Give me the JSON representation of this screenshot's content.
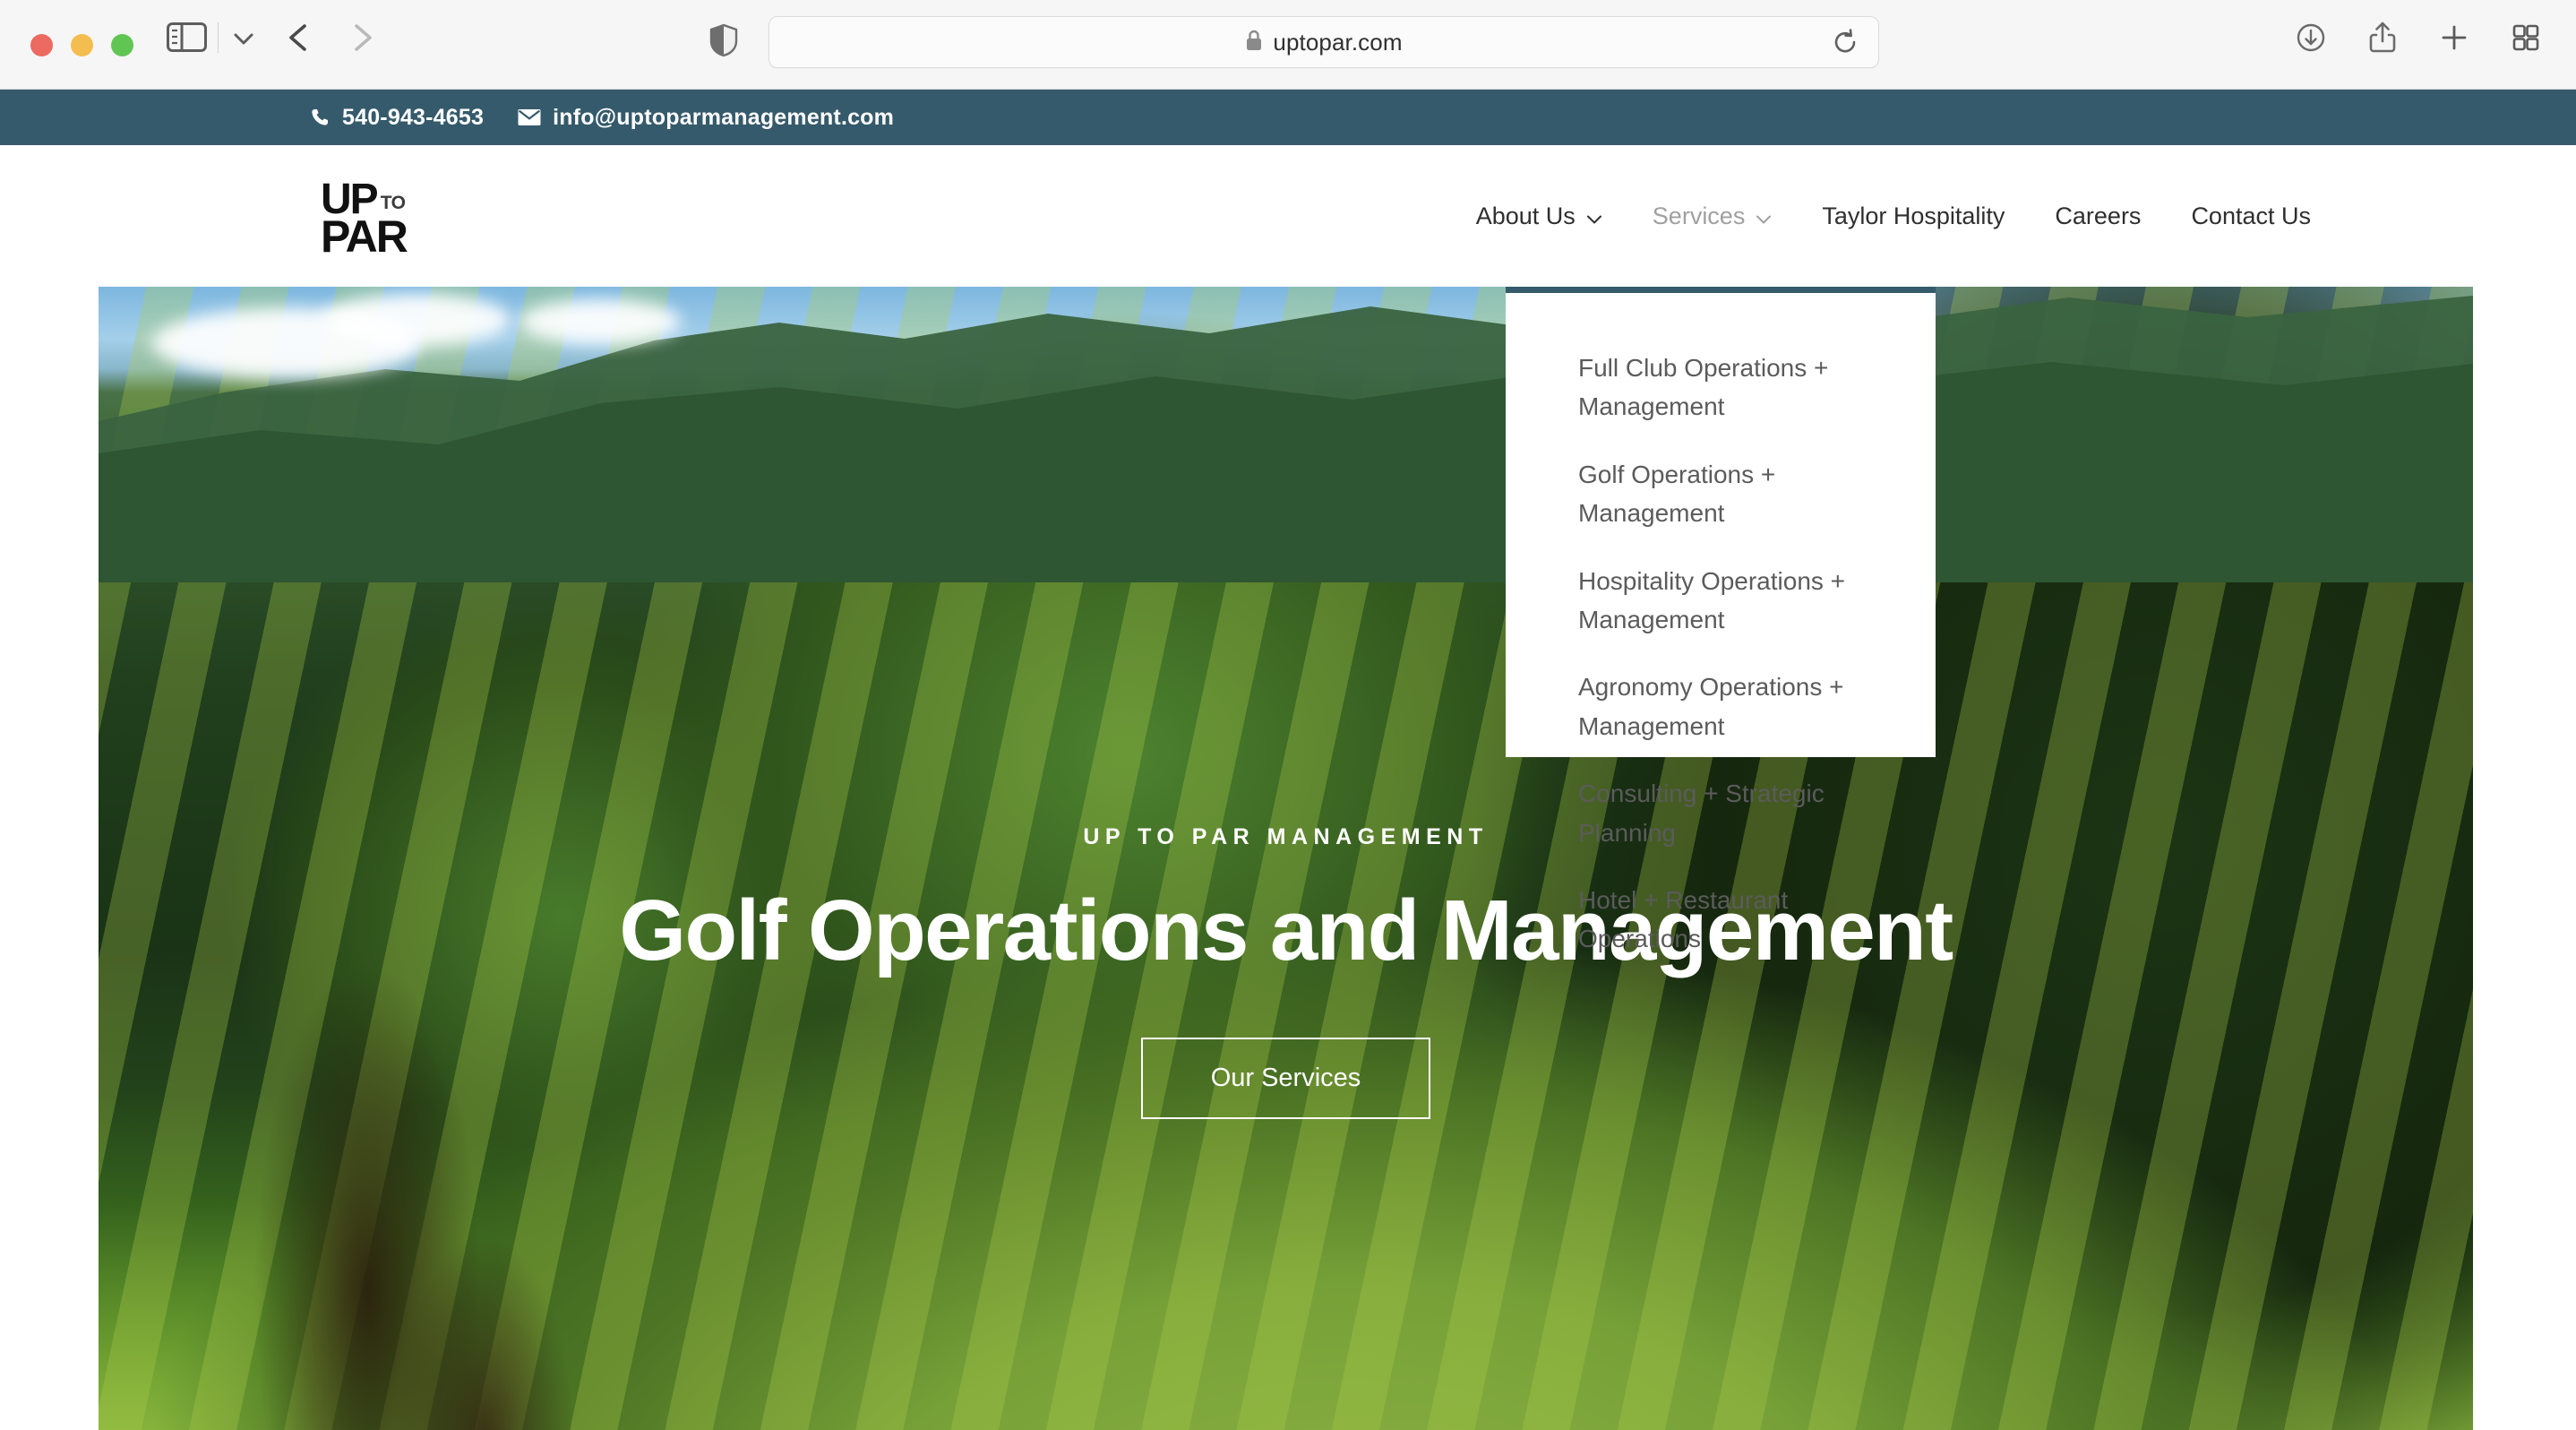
{
  "browser": {
    "url": "uptopar.com",
    "icons": {
      "sidebar": "sidebar-toggle-icon",
      "sidebar_chevron": "chevron-down-icon",
      "back": "back-arrow-icon",
      "forward": "forward-arrow-icon",
      "shield": "privacy-shield-icon",
      "lock": "lock-icon",
      "reload": "reload-icon",
      "downloads": "downloads-icon",
      "share": "share-icon",
      "new_tab": "plus-icon",
      "tab_overview": "tab-overview-icon"
    }
  },
  "topbar": {
    "phone": "540-943-4653",
    "email": "info@uptoparmanagement.com",
    "bg_color": "#355a6b"
  },
  "header": {
    "logo": {
      "line1": "UP",
      "small": "TO",
      "line2": "PAR"
    },
    "nav": [
      {
        "label": "About Us",
        "has_chevron": true,
        "open": false
      },
      {
        "label": "Services",
        "has_chevron": true,
        "open": true
      },
      {
        "label": "Taylor Hospitality",
        "has_chevron": false,
        "open": false
      },
      {
        "label": "Careers",
        "has_chevron": false,
        "open": false
      },
      {
        "label": "Contact Us",
        "has_chevron": false,
        "open": false
      }
    ]
  },
  "services_dropdown": {
    "accent_color": "#355a6b",
    "items": [
      "Full Club Operations + Management",
      "Golf Operations + Management",
      "Hospitality Operations + Management",
      "Agronomy Operations + Management",
      "Consulting + Strategic Planning",
      "Hotel + Restaurant Operations"
    ]
  },
  "hero": {
    "eyebrow": "UP TO PAR MANAGEMENT",
    "title": "Golf Operations and Management",
    "cta_label": "Our Services"
  }
}
